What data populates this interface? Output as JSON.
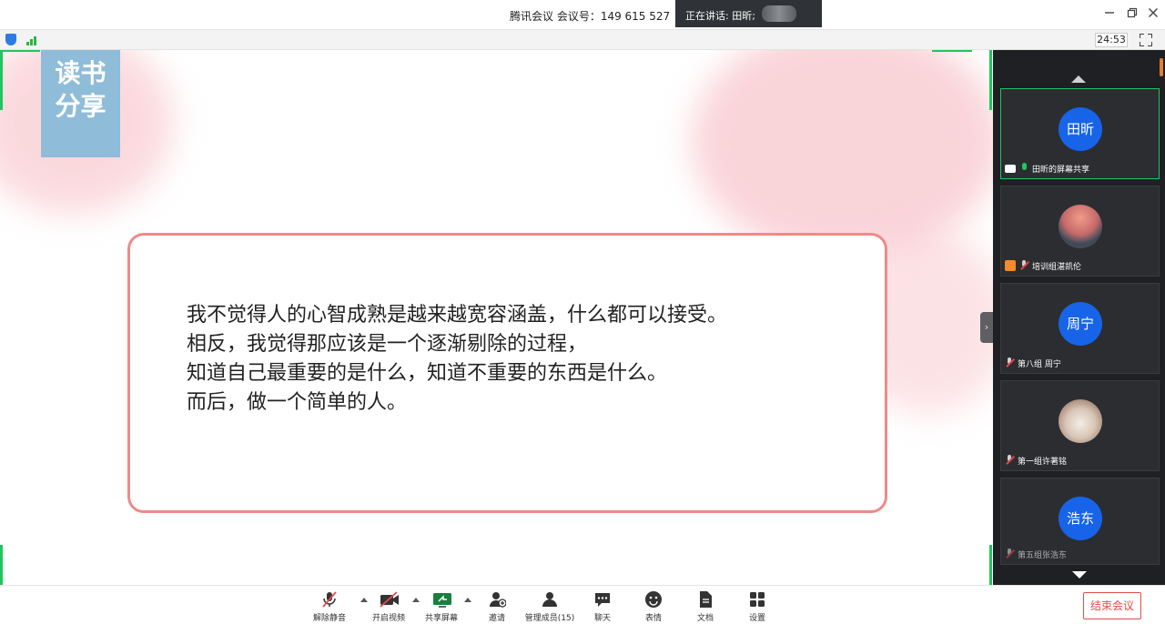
{
  "titlebar": {
    "meeting_title": "腾讯会议  会议号：149 615 527",
    "speaking_label": "正在讲话: 田昕;"
  },
  "statusbar": {
    "timer": "24:53"
  },
  "slide": {
    "tag_line1": "读书",
    "tag_line2": "分享",
    "quote_lines": [
      "我不觉得人的心智成熟是越来越宽容涵盖，什么都可以接受。",
      "相反，我觉得那应该是一个逐渐剔除的过程，",
      "知道自己最重要的是什么，知道不重要的东西是什么。",
      "而后，做一个简单的人。"
    ]
  },
  "participants": [
    {
      "avatar_text": "田昕",
      "label": "田昕的屏幕共享",
      "avatar_style": "blue",
      "active": true
    },
    {
      "avatar_text": "",
      "label": "培训组湛凯伦",
      "avatar_style": "photo1",
      "active": false
    },
    {
      "avatar_text": "周宁",
      "label": "第八组 周宁",
      "avatar_style": "blue",
      "active": false
    },
    {
      "avatar_text": "",
      "label": "第一组许著铭",
      "avatar_style": "photo2",
      "active": false
    },
    {
      "avatar_text": "浩东",
      "label": "第五组张浩东",
      "avatar_style": "blue",
      "active": false
    }
  ],
  "toolbar": {
    "unmute": "解除静音",
    "video": "开启视频",
    "share": "共享屏幕",
    "invite": "邀请",
    "members": "管理成员(15)",
    "chat": "聊天",
    "reactions": "表情",
    "docs": "文档",
    "settings": "设置",
    "end_meeting": "结束会议"
  },
  "colors": {
    "accent_green": "#22c55e",
    "avatar_blue": "#1764e8",
    "end_red": "#e54b4b",
    "quote_border": "#ef8a8a",
    "tag_blue": "#8fbcd8"
  }
}
